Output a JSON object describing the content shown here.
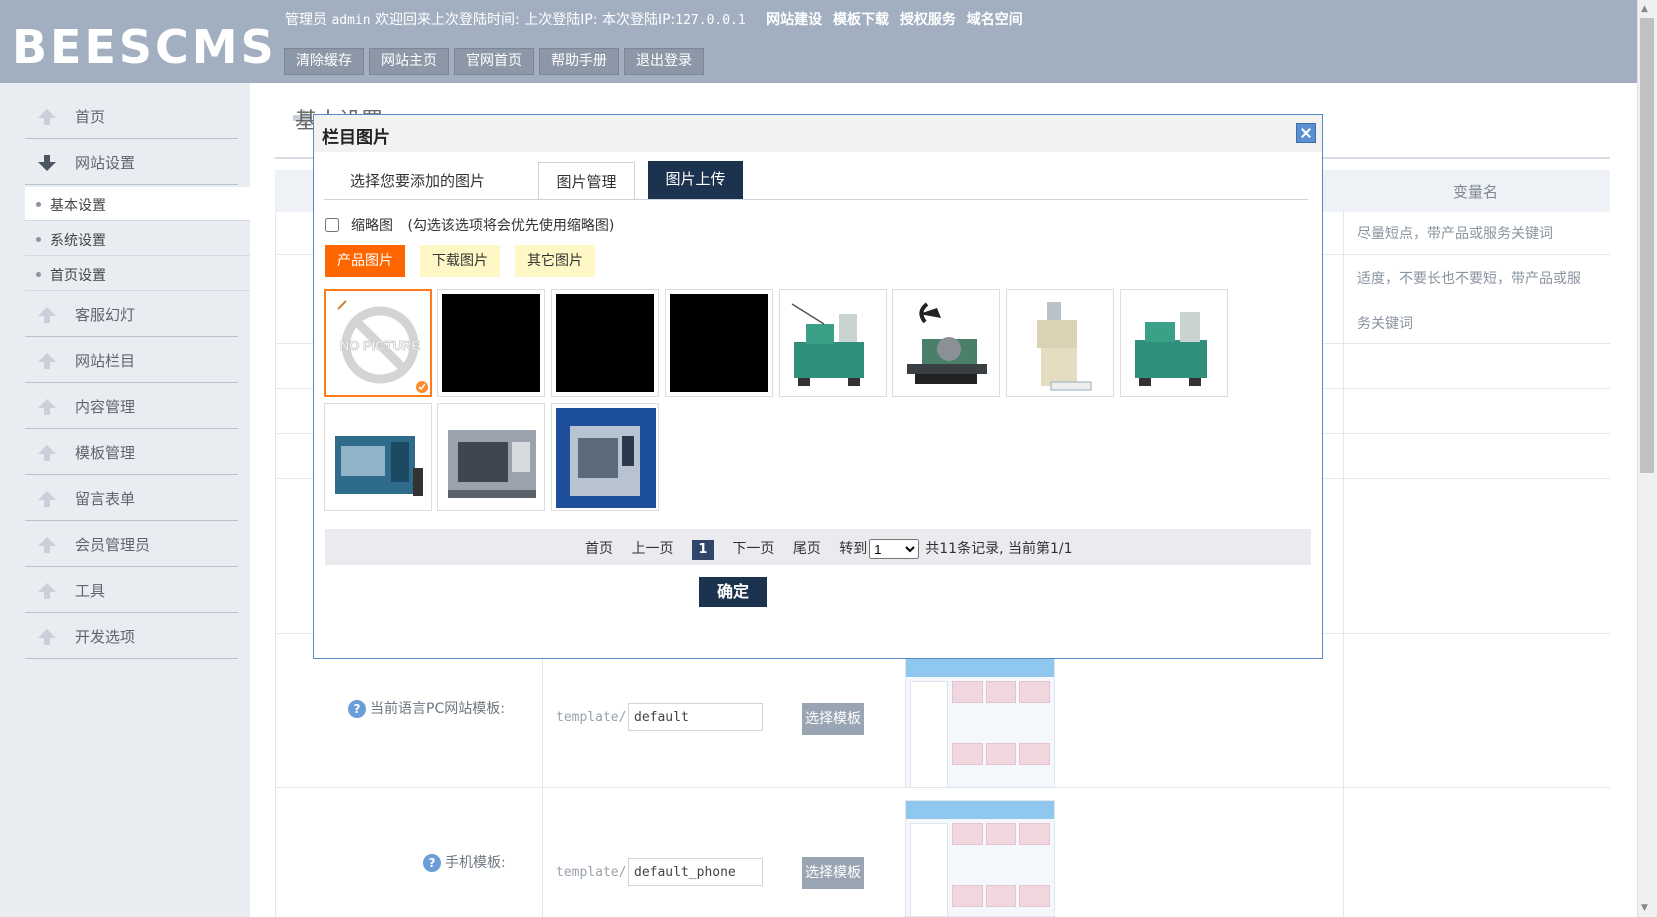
{
  "header": {
    "logo": "BEESCMS",
    "welcome_prefix": "管理员",
    "username": "admin",
    "welcome_suffix": "欢迎回来上次登陆时间:",
    "last_ip_label": "上次登陆IP:",
    "current_ip_label": "本次登陆IP:",
    "current_ip": "127.0.0.1",
    "links": [
      "网站建设",
      "模板下载",
      "授权服务",
      "域名空间"
    ],
    "buttons": [
      "清除缓存",
      "网站主页",
      "官网首页",
      "帮助手册",
      "退出登录"
    ]
  },
  "sidebar": {
    "items": [
      {
        "label": "首页"
      },
      {
        "label": "网站设置"
      },
      {
        "label": "客服幻灯"
      },
      {
        "label": "网站栏目"
      },
      {
        "label": "内容管理"
      },
      {
        "label": "模板管理"
      },
      {
        "label": "留言表单"
      },
      {
        "label": "会员管理员"
      },
      {
        "label": "工具"
      },
      {
        "label": "开发选项"
      }
    ],
    "subitems": [
      {
        "label": "基本设置",
        "active": true
      },
      {
        "label": "系统设置",
        "active": false
      },
      {
        "label": "首页设置",
        "active": false
      }
    ]
  },
  "main": {
    "page_title": "基本设置",
    "column_varname": "变量名",
    "hint_1": "尽量短点，带产品或服务关键词",
    "hint_2_line1": "适度，不要长也不要短，带产品或服",
    "hint_2_line2": "务关键词",
    "pc_template_label": "当前语言PC网站模板:",
    "mobile_template_label": "手机模板:",
    "template_prefix": "template/",
    "pc_template_value": "default",
    "mobile_template_value": "default_phone",
    "choose_template_label": "选择模板"
  },
  "dialog": {
    "title": "栏目图片",
    "tab_choose": "选择您要添加的图片",
    "tab_manage": "图片管理",
    "tab_upload": "图片上传",
    "thumb_label": "缩略图",
    "thumb_hint": "(勾选该选项将会优先使用缩略图)",
    "categories": [
      "产品图片",
      "下载图片",
      "其它图片"
    ],
    "no_picture_text": "NO PICTURE",
    "images": [
      {
        "kind": "nopic"
      },
      {
        "kind": "black"
      },
      {
        "kind": "black"
      },
      {
        "kind": "black"
      },
      {
        "kind": "machine",
        "color": "#2f8f7a"
      },
      {
        "kind": "machine",
        "color": "#4a7f6a"
      },
      {
        "kind": "machine",
        "color": "#d9d2b4"
      },
      {
        "kind": "machine",
        "color": "#2f8f7a"
      },
      {
        "kind": "cnc",
        "color": "#2f6c8c"
      },
      {
        "kind": "cnc",
        "color": "#9aa3ad"
      },
      {
        "kind": "cnc",
        "color": "#1e4f9a"
      }
    ],
    "pager": {
      "first": "首页",
      "prev": "上一页",
      "current": "1",
      "next": "下一页",
      "last": "尾页",
      "goto": "转到",
      "goto_value": "1",
      "summary": "共11条记录, 当前第1/1"
    },
    "confirm": "确定"
  },
  "colors": {
    "header_bg": "#a2afc1",
    "sidebar_bg": "#e9edf2",
    "accent_orange": "#ff6600",
    "dark_navy": "#1c3350",
    "dialog_border": "#5b88c7"
  }
}
